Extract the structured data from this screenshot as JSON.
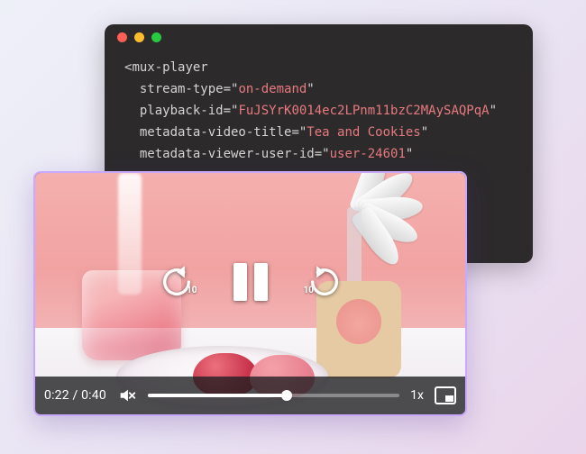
{
  "code": {
    "tag": "mux-player",
    "attrs": [
      {
        "name": "stream-type",
        "value": "on-demand"
      },
      {
        "name": "playback-id",
        "value": "FuJSYrK0014ec2LPnm11bzC2MAySAQPqA"
      },
      {
        "name": "metadata-video-title",
        "value": "Tea and Cookies"
      },
      {
        "name": "metadata-viewer-user-id",
        "value": "user-24601"
      }
    ]
  },
  "player": {
    "current_time": "0:22",
    "duration": "0:40",
    "time_display": "0:22 / 0:40",
    "progress_percent": 55,
    "seek_back_seconds": "10",
    "seek_forward_seconds": "10",
    "playback_rate_label": "1x",
    "muted": true,
    "state": "playing"
  },
  "colors": {
    "accent": "#c9a9ff",
    "code_bg": "#2c2a2b",
    "code_string": "#e77a7f"
  }
}
